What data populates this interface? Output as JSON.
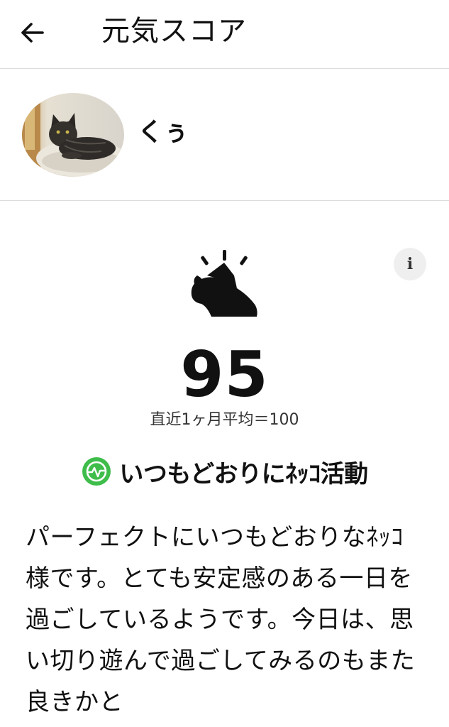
{
  "header": {
    "back_icon": "arrow-left-icon",
    "title": "元気スコア"
  },
  "profile": {
    "avatar_icon": "cat-photo",
    "name": "くぅ"
  },
  "score_card": {
    "info_label": "i",
    "mood_icon": "cat-happy-icon",
    "score": "95",
    "average_text": "直近1ヶ月平均＝100",
    "status_icon": "heartbeat-check-icon",
    "status_color": "#3ebd4a",
    "status_text": "いつもどおりにﾈｯｺ活動"
  },
  "description": "パーフェクトにいつもどおりなﾈｯｺ様です。とても安定感のある一日を過ごしているようです。今日は、思い切り遊んで過ごしてみるのもまた良きかと"
}
